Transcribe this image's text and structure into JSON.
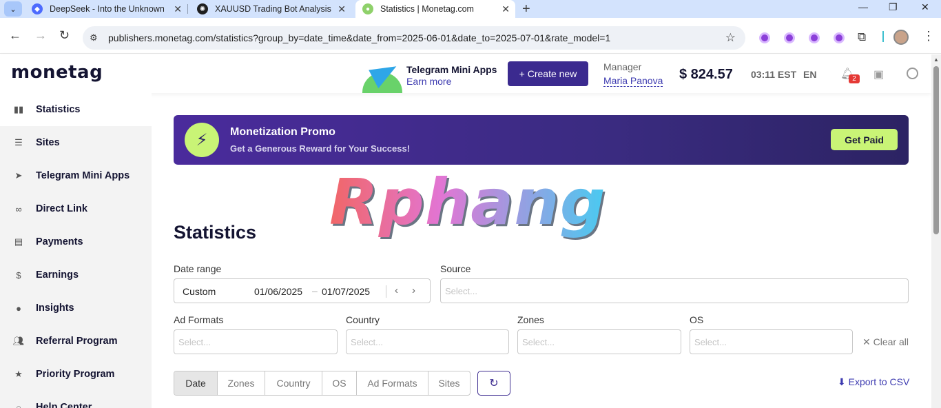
{
  "browser": {
    "tabs": [
      {
        "title": "DeepSeek - Into the Unknown"
      },
      {
        "title": "XAUUSD Trading Bot Analysis"
      },
      {
        "title": "Statistics | Monetag.com"
      }
    ],
    "url": "publishers.monetag.com/statistics?group_by=date_time&date_from=2025-06-01&date_to=2025-07-01&rate_model=1"
  },
  "header": {
    "logo": "monetag",
    "telegram": {
      "title": "Telegram Mini Apps",
      "link": "Earn more"
    },
    "create_label": "+ Create new",
    "manager_label": "Manager",
    "manager_name": "Maria Panova",
    "balance": "$ 824.57",
    "time": "03:11 EST",
    "lang": "EN",
    "notification_count": "2"
  },
  "sidebar": {
    "items": [
      {
        "label": "Statistics",
        "icon": "bar-chart-icon",
        "active": true
      },
      {
        "label": "Sites",
        "icon": "sites-icon"
      },
      {
        "label": "Telegram Mini Apps",
        "icon": "telegram-icon"
      },
      {
        "label": "Direct Link",
        "icon": "link-icon"
      },
      {
        "label": "Payments",
        "icon": "payments-icon"
      },
      {
        "label": "Earnings",
        "icon": "dollar-icon"
      },
      {
        "label": "Insights",
        "icon": "help-circle-icon"
      },
      {
        "label": "Referral Program",
        "icon": "people-icon"
      },
      {
        "label": "Priority Program",
        "icon": "star-icon"
      },
      {
        "label": "Help Center",
        "icon": "search-icon"
      }
    ]
  },
  "promo": {
    "title": "Monetization Promo",
    "subtitle": "Get a Generous Reward for Your Success!",
    "button": "Get Paid"
  },
  "watermark": "Rphang",
  "page_title": "Statistics",
  "filters": {
    "date_range_label": "Date range",
    "date_preset": "Custom",
    "date_from": "01/06/2025",
    "date_to": "01/07/2025",
    "source_label": "Source",
    "ad_formats_label": "Ad Formats",
    "country_label": "Country",
    "zones_label": "Zones",
    "os_label": "OS",
    "placeholder": "Select...",
    "clear_all": "Clear all"
  },
  "group_tabs": [
    "Date",
    "Zones",
    "Country",
    "OS",
    "Ad Formats",
    "Sites"
  ],
  "export_label": "Export to CSV"
}
